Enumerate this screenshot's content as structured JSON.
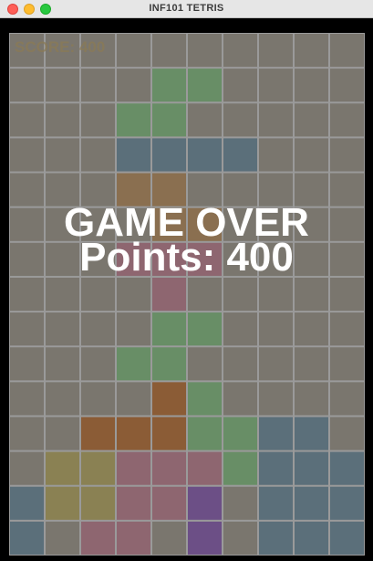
{
  "window": {
    "title": "INF101 TETRIS"
  },
  "game": {
    "score_label": "SCORE: 400",
    "game_over_text": "GAME OVER",
    "points_text": "Points: 400",
    "colors": {
      "empty": "#7a766e",
      "grid_line": "#9a9a9a",
      "G": "#688e66",
      "B": "#5b6f7a",
      "O": "#8a6f50",
      "D": "#8b5c36",
      "P": "#8e6670",
      "Y": "#8a8153",
      "V": "#6c4f86"
    },
    "rows": [
      "..........",
      "....GG....",
      "...GG.....",
      "...BBBB...",
      "...OO.....",
      "....OO....",
      "...PPP....",
      "....P.....",
      "....GG....",
      "...GG.....",
      "....DG....",
      "..DDDGGBB.",
      ".YYPPPGBBB",
      "BYYPPV.BBB",
      "B.PP.V.BBB"
    ]
  }
}
